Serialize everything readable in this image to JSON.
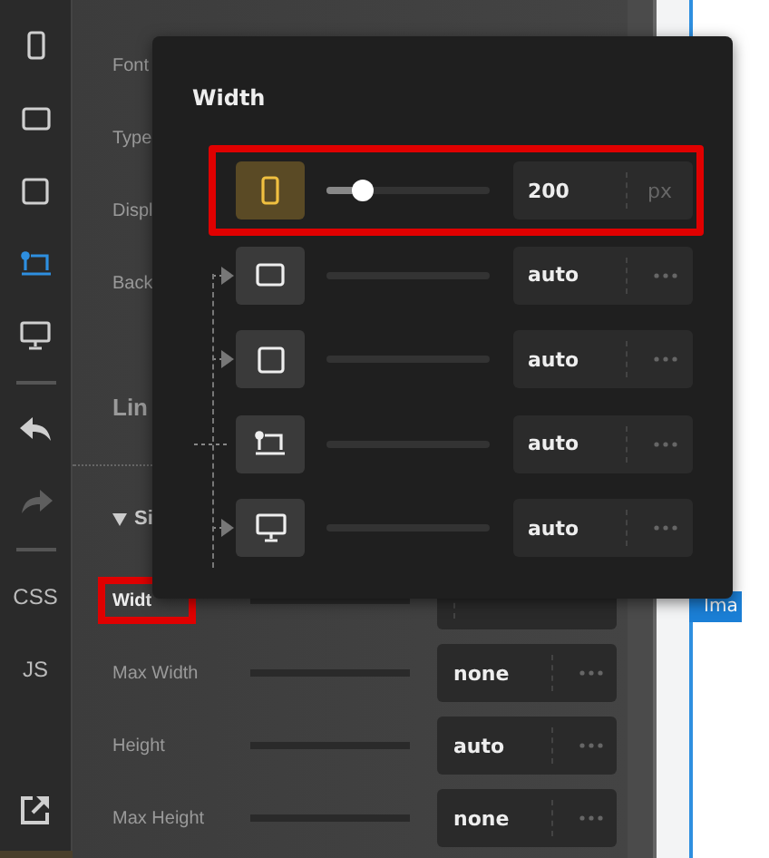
{
  "toolbar": [
    {
      "kind": "phone",
      "selected": false,
      "disabled": false
    },
    {
      "kind": "tablet-wide",
      "selected": false,
      "disabled": false
    },
    {
      "kind": "tablet",
      "selected": false,
      "disabled": false
    },
    {
      "kind": "laptop",
      "selected": true,
      "disabled": false
    },
    {
      "kind": "desktop",
      "selected": false,
      "disabled": false
    },
    {
      "kind": "divider"
    },
    {
      "kind": "undo",
      "selected": false,
      "disabled": false
    },
    {
      "kind": "redo",
      "selected": false,
      "disabled": true
    },
    {
      "kind": "divider"
    },
    {
      "kind": "text",
      "label": "CSS"
    },
    {
      "kind": "text",
      "label": "JS"
    },
    {
      "kind": "spacer"
    },
    {
      "kind": "external",
      "selected": false,
      "disabled": false
    }
  ],
  "panel": {
    "labels": [
      "Font",
      "Type",
      "Displ",
      "Back"
    ],
    "group_title": "Lin",
    "section": {
      "title": "Si",
      "expanded": true
    },
    "rows": [
      {
        "label": "Widt",
        "highlighted": true
      },
      {
        "label": "Max Width",
        "highlighted": false,
        "value": "none"
      },
      {
        "label": "Height",
        "highlighted": false,
        "value": "auto"
      },
      {
        "label": "Max Height",
        "highlighted": false,
        "value": "none"
      }
    ]
  },
  "popup": {
    "title": "Width",
    "rows": [
      {
        "kind": "phone",
        "active": true,
        "highlighted": true,
        "level": 0.22,
        "value": "200",
        "unit": "px"
      },
      {
        "kind": "tablet-wide",
        "active": false,
        "highlighted": false,
        "value": "auto"
      },
      {
        "kind": "tablet",
        "active": false,
        "highlighted": false,
        "value": "auto"
      },
      {
        "kind": "laptop",
        "active": false,
        "highlighted": false,
        "value": "auto"
      },
      {
        "kind": "desktop",
        "active": false,
        "highlighted": false,
        "value": "auto"
      }
    ]
  },
  "canvas": {
    "tag": "Ima"
  }
}
